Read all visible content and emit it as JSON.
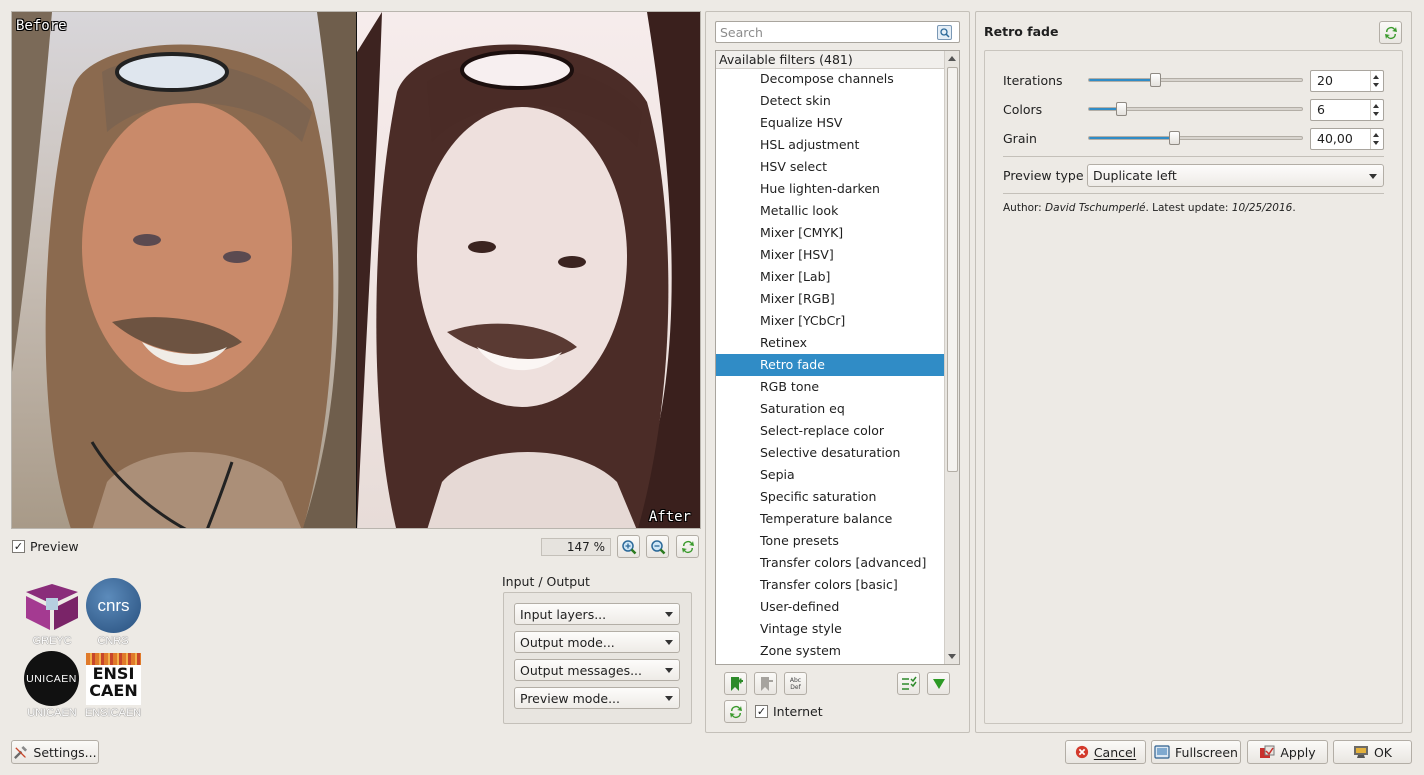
{
  "preview": {
    "before_label": "Before",
    "after_label": "After",
    "checkbox_checked": true,
    "checkbox_label": "Preview",
    "zoom": "147 %"
  },
  "logos": {
    "greyc": "GREYC",
    "cnrs": "CNRS",
    "cnrs_mark": "cnrs",
    "unicaen": "UNICAEN",
    "unicaen_mark": "UNICAEN",
    "ensicaen": "ENSICAEN",
    "ensicaen_mark_1": "ENSI",
    "ensicaen_mark_2": "CAEN"
  },
  "io": {
    "title": "Input / Output",
    "input_layers": "Input layers...",
    "output_mode": "Output mode...",
    "output_messages": "Output messages...",
    "preview_mode": "Preview mode..."
  },
  "filters": {
    "search_placeholder": "Search",
    "header": "Available filters (481)",
    "items": [
      "Decompose channels",
      "Detect skin",
      "Equalize HSV",
      "HSL adjustment",
      "HSV select",
      "Hue lighten-darken",
      "Metallic look",
      "Mixer [CMYK]",
      "Mixer [HSV]",
      "Mixer [Lab]",
      "Mixer [RGB]",
      "Mixer [YCbCr]",
      "Retinex",
      "Retro fade",
      "RGB tone",
      "Saturation eq",
      "Select-replace color",
      "Selective desaturation",
      "Sepia",
      "Specific saturation",
      "Temperature balance",
      "Tone presets",
      "Transfer colors [advanced]",
      "Transfer colors [basic]",
      "User-defined",
      "Vintage style",
      "Zone system"
    ],
    "selected": "Retro fade",
    "internet_label": "Internet",
    "internet_checked": true,
    "abc_def_1": "Abc",
    "abc_def_2": "Def"
  },
  "params": {
    "title": "Retro fade",
    "iterations": {
      "label": "Iterations",
      "value": "20",
      "fraction": 0.31
    },
    "colors": {
      "label": "Colors",
      "value": "6",
      "fraction": 0.15
    },
    "grain": {
      "label": "Grain",
      "value": "40,00",
      "fraction": 0.4
    },
    "preview_type_label": "Preview type",
    "preview_type_value": "Duplicate left",
    "author_prefix": "Author: ",
    "author_name": "David Tschumperlé",
    "update_prefix": ". Latest update: ",
    "update_date": "10/25/2016",
    "update_suffix": "."
  },
  "buttons": {
    "settings": "Settings...",
    "cancel": "Cancel",
    "fullscreen": "Fullscreen",
    "apply": "Apply",
    "ok": "OK"
  },
  "colors": {
    "selection": "#308cc6",
    "window_bg": "#edeae5"
  }
}
